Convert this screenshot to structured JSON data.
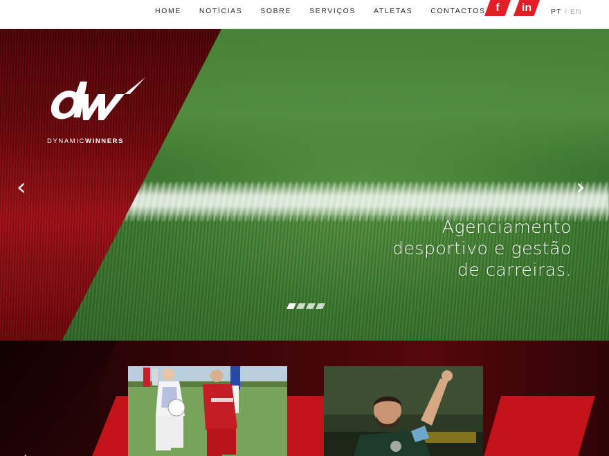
{
  "nav": {
    "items": [
      {
        "label": "HOME"
      },
      {
        "label": "NOTÍCIAS"
      },
      {
        "label": "SOBRE"
      },
      {
        "label": "SERVIÇOS"
      },
      {
        "label": "ATLETAS"
      },
      {
        "label": "CONTACTOS"
      }
    ]
  },
  "social": {
    "facebook_glyph": "f",
    "linkedin_glyph": "in"
  },
  "lang": {
    "active": "PT",
    "separator": "/",
    "other": "EN"
  },
  "brand": {
    "name_light": "DYNAMIC",
    "name_bold": "WINNERS",
    "accent_color": "#e41e26"
  },
  "hero": {
    "tagline_line1": "Agenciamento",
    "tagline_line2": "desportivo e gestão",
    "tagline_line3": "de carreiras.",
    "prev_arrow": "‹",
    "next_arrow": "›",
    "slides_count": 4,
    "active_slide": 1
  },
  "athletes": {
    "prev_arrow": "‹"
  }
}
